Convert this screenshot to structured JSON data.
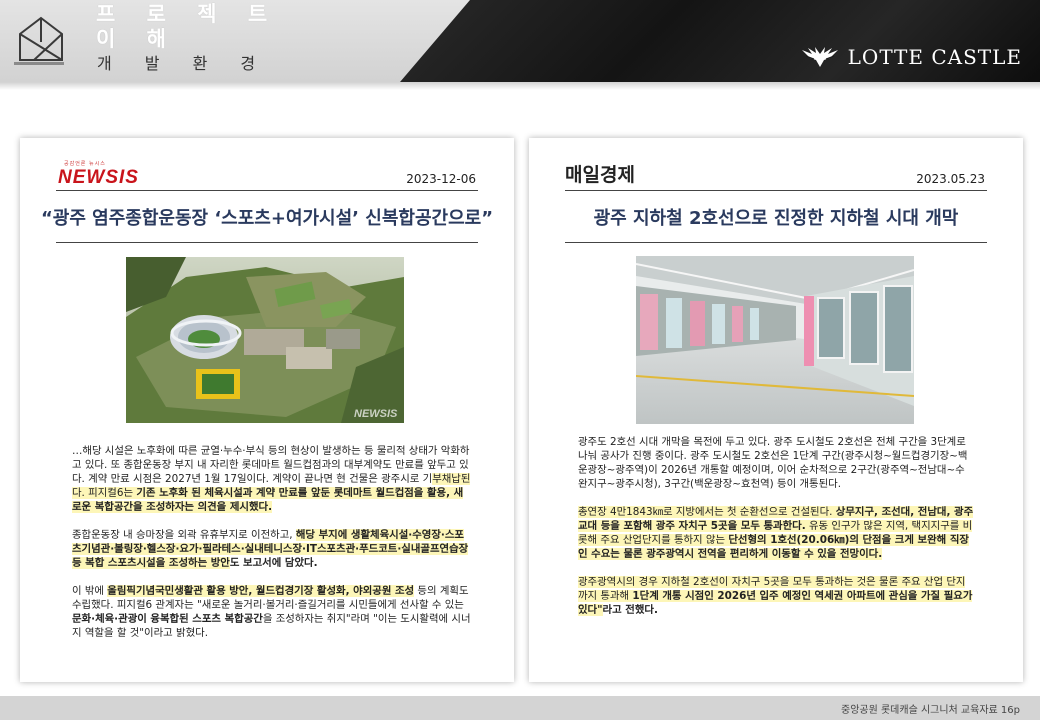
{
  "header": {
    "title_lines": [
      "프 로 젝 트",
      "이 해"
    ],
    "subtitle": "개 발 환 경",
    "brand": "LOTTE CASTLE"
  },
  "articles": [
    {
      "publisher_tagline": "공감언론 뉴시스",
      "publisher": "NEWSIS",
      "date": "2023-12-06",
      "headline": "“광주 염주종합운동장 ‘스포츠+여가시설’ 신복합공간으로”",
      "photo_watermark": "NEWSIS",
      "paragraphs": [
        [
          {
            "t": "…해당 시설은 노후화에 따른 균열·누수·부식 등의 현상이 발생하는 등 물리적 상태가 악화하고 있다. 또 종합운동장 부지 내 자리한 롯데마트 월드컵점과의 대부계약도 만료를 앞두고 있다. 계약 만료 시점은 2027년 1월 17일이다. 계약이 끝나면 현 건물은 광주시로 기",
            "s": ""
          },
          {
            "t": "부채납된다. 피지컬6는 ",
            "s": "hl"
          },
          {
            "t": "기존 노후화 된 체육시설과 계약 만료를 앞둔 롯데마트 월드컵점을 활용, 새로운 복합공간을 조성하자는 의견을 제시했다.",
            "s": "hlb"
          }
        ],
        [
          {
            "t": "종합운동장 내 승마장을 외곽 유휴부지로 이전하고, ",
            "s": ""
          },
          {
            "t": "해당 부지에 생활체육시설·수영장·스포츠기념관·볼링장·헬스장·요가·필라테스·실내테니스장·IT스포츠관·푸드코트·실내골프연습장 등 복합 스포츠시설을 조성하는 방안",
            "s": "hlb"
          },
          {
            "t": "도 보고서에 담았다.",
            "s": "b"
          }
        ],
        [
          {
            "t": "이 밖에 ",
            "s": ""
          },
          {
            "t": "올림픽기념국민생활관 활용 방안, 월드컵경기장 활성화, 야외공원 조성",
            "s": "hlb"
          },
          {
            "t": " 등의 계획도 수립했다. 피지컬6 관계자는 \"새로운 놀거리·볼거리·즐길거리를 시민들에게 선사할 수 있는 ",
            "s": ""
          },
          {
            "t": "문화·체육·관광이 융복합된 스포츠 복합공간",
            "s": "b"
          },
          {
            "t": "을 조성하자는 취지\"라며 \"이는 도시활력에 시너지 역할을 할 것\"이라고 밝혔다.",
            "s": ""
          }
        ]
      ]
    },
    {
      "publisher": "매일경제",
      "date": "2023.05.23",
      "headline": "광주 지하철 2호선으로 진정한 지하철 시대 개막",
      "paragraphs": [
        [
          {
            "t": "광주도 2호선 시대 개막을 목전에 두고 있다. 광주 도시철도 2호선은 전체 구간을 3단계로 나눠 공사가 진행 중이다. 광주 도시철도 2호선은 1단계 구간(광주시청~월드컵경기장~백운광장~광주역)이 2026년 개통할 예정이며, 이어 순차적으로 2구간(광주역~전남대~수완지구~광주시청), 3구간(백운광장~효천역) 등이 개통된다.",
            "s": ""
          }
        ],
        [
          {
            "t": "총연장 4만1843㎞로 지방에서는 첫 순환선으로 건설된다. ",
            "s": "hl"
          },
          {
            "t": "상무지구, 조선대, 전남대, 광주교대 등을 포함해 광주 자치구 5곳을 모두 통과한다.",
            "s": "hlb"
          },
          {
            "t": " 유동 인구가 많은 지역, 택지지구를 비롯해 주요 산업단지를 통하지 않는 ",
            "s": "hl"
          },
          {
            "t": "단선형의 1호선(20.06㎞)의 단점을 크게 보완해 직장인 수요는 물론 광주광역시 전역을 편리하게 이동할 수 있을 전망이다.",
            "s": "hlb"
          }
        ],
        [
          {
            "t": "광주광역시의 경우 지하철 2호선이 자치구 5곳을 모두 통과하는 것은 물론 주요 산업 단지까지 통과해 ",
            "s": "hl"
          },
          {
            "t": "1단계 개통 시점인 2026년 입주 예정인 역세권 아파트에 관심을 가질 필요가 있다\"",
            "s": "hlb"
          },
          {
            "t": "라고 전했다.",
            "s": "b"
          }
        ]
      ]
    }
  ],
  "footer": {
    "text": "중앙공원 롯데캐슬 시그니처 교육자료 16p"
  },
  "colors": {
    "highlight": "#fdf6b8",
    "headline": "#2a3a5e",
    "newsis_red": "#c9141b"
  }
}
